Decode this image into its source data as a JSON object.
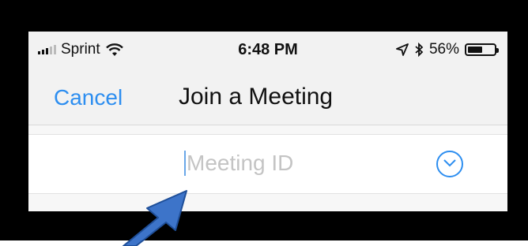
{
  "status_bar": {
    "carrier": "Sprint",
    "time": "6:48 PM",
    "battery": "56%",
    "battery_level": 0.56,
    "icons": [
      "signal-bars-icon",
      "wifi-icon",
      "location-arrow-icon",
      "bluetooth-icon",
      "battery-icon"
    ]
  },
  "nav": {
    "cancel_label": "Cancel",
    "title": "Join a Meeting"
  },
  "meeting_field": {
    "value": "",
    "placeholder": "Meeting ID",
    "dropdown_icon": "chevron-down-circle-icon"
  },
  "annotation": {
    "icon": "pointer-arrow-icon"
  },
  "colors": {
    "accent": "#2d8ef0",
    "frame": "#000000",
    "arrow": "#3d74c9"
  }
}
